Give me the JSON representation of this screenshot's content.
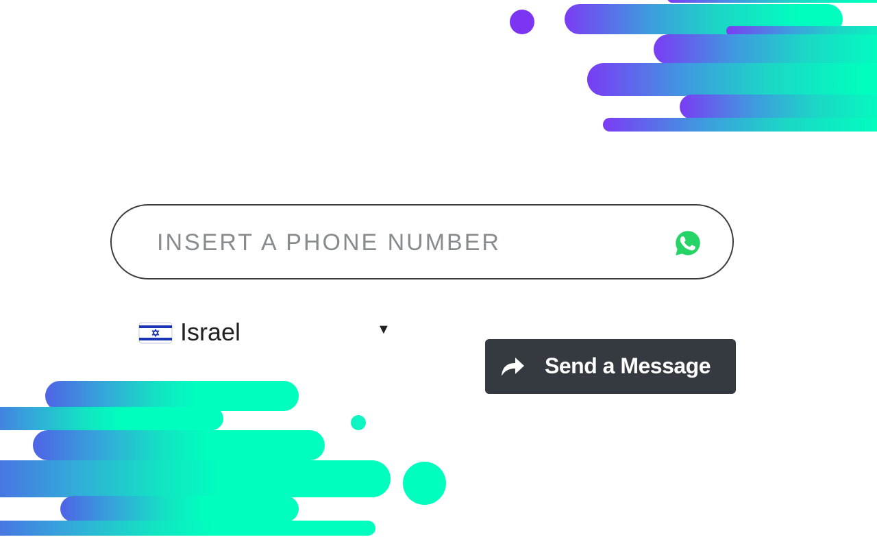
{
  "phone": {
    "placeholder": "INSERT A PHONE NUMBER",
    "value": "",
    "icon": "whatsapp-icon"
  },
  "country": {
    "selected": "Israel",
    "flag_icon": "israel-flag-icon",
    "caret_glyph": "▼"
  },
  "send_button": {
    "label": "Send a Message",
    "icon": "share-arrow-icon"
  },
  "colors": {
    "accent_purple": "#7a3cf4",
    "accent_mint": "#00ffbe",
    "button_bg": "#343a40",
    "whatsapp_green": "#25d366"
  }
}
